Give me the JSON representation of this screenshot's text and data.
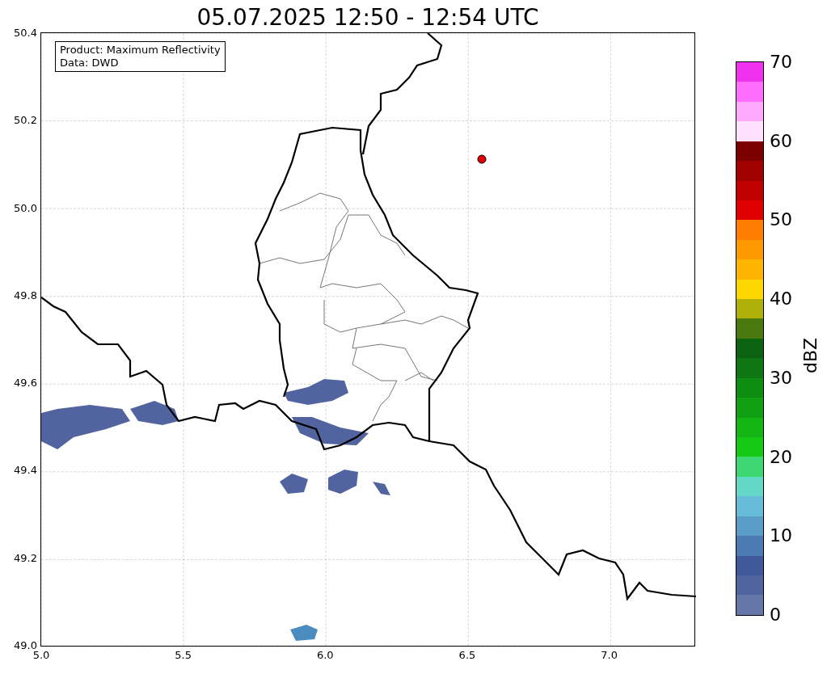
{
  "title": "05.07.2025 12:50 - 12:54 UTC",
  "map": {
    "legend": [
      "Product: Maximum Reflectivity",
      "Data: DWD"
    ],
    "y_ticks": [
      "50.4",
      "50.2",
      "50.0",
      "49.8",
      "49.6",
      "49.4",
      "49.2",
      "49.0"
    ],
    "x_ticks": [
      "5.0",
      "5.5",
      "6.0",
      "6.5",
      "7.0"
    ]
  },
  "colorbar": {
    "ticks": [
      "70",
      "60",
      "50",
      "40",
      "30",
      "20",
      "10",
      "0"
    ],
    "label": "dBZ",
    "segments": [
      {
        "color": "#f032f0"
      },
      {
        "color": "#ff6eff"
      },
      {
        "color": "#ffaaff"
      },
      {
        "color": "#ffe0ff"
      },
      {
        "color": "#7c0000"
      },
      {
        "color": "#a00000"
      },
      {
        "color": "#c00000"
      },
      {
        "color": "#e00000"
      },
      {
        "color": "#ff7d00"
      },
      {
        "color": "#ff9900"
      },
      {
        "color": "#ffb400"
      },
      {
        "color": "#ffd700"
      },
      {
        "color": "#b0b00a"
      },
      {
        "color": "#4a7a0e"
      },
      {
        "color": "#0b6210"
      },
      {
        "color": "#0e7612"
      },
      {
        "color": "#0f8c12"
      },
      {
        "color": "#10a012"
      },
      {
        "color": "#12b514"
      },
      {
        "color": "#14c814"
      },
      {
        "color": "#3ed872"
      },
      {
        "color": "#63d8c8"
      },
      {
        "color": "#66bcd8"
      },
      {
        "color": "#5a9dc8"
      },
      {
        "color": "#4a7ab0"
      },
      {
        "color": "#40599d"
      },
      {
        "color": "#52649f"
      },
      {
        "color": "#6577a8"
      }
    ]
  }
}
